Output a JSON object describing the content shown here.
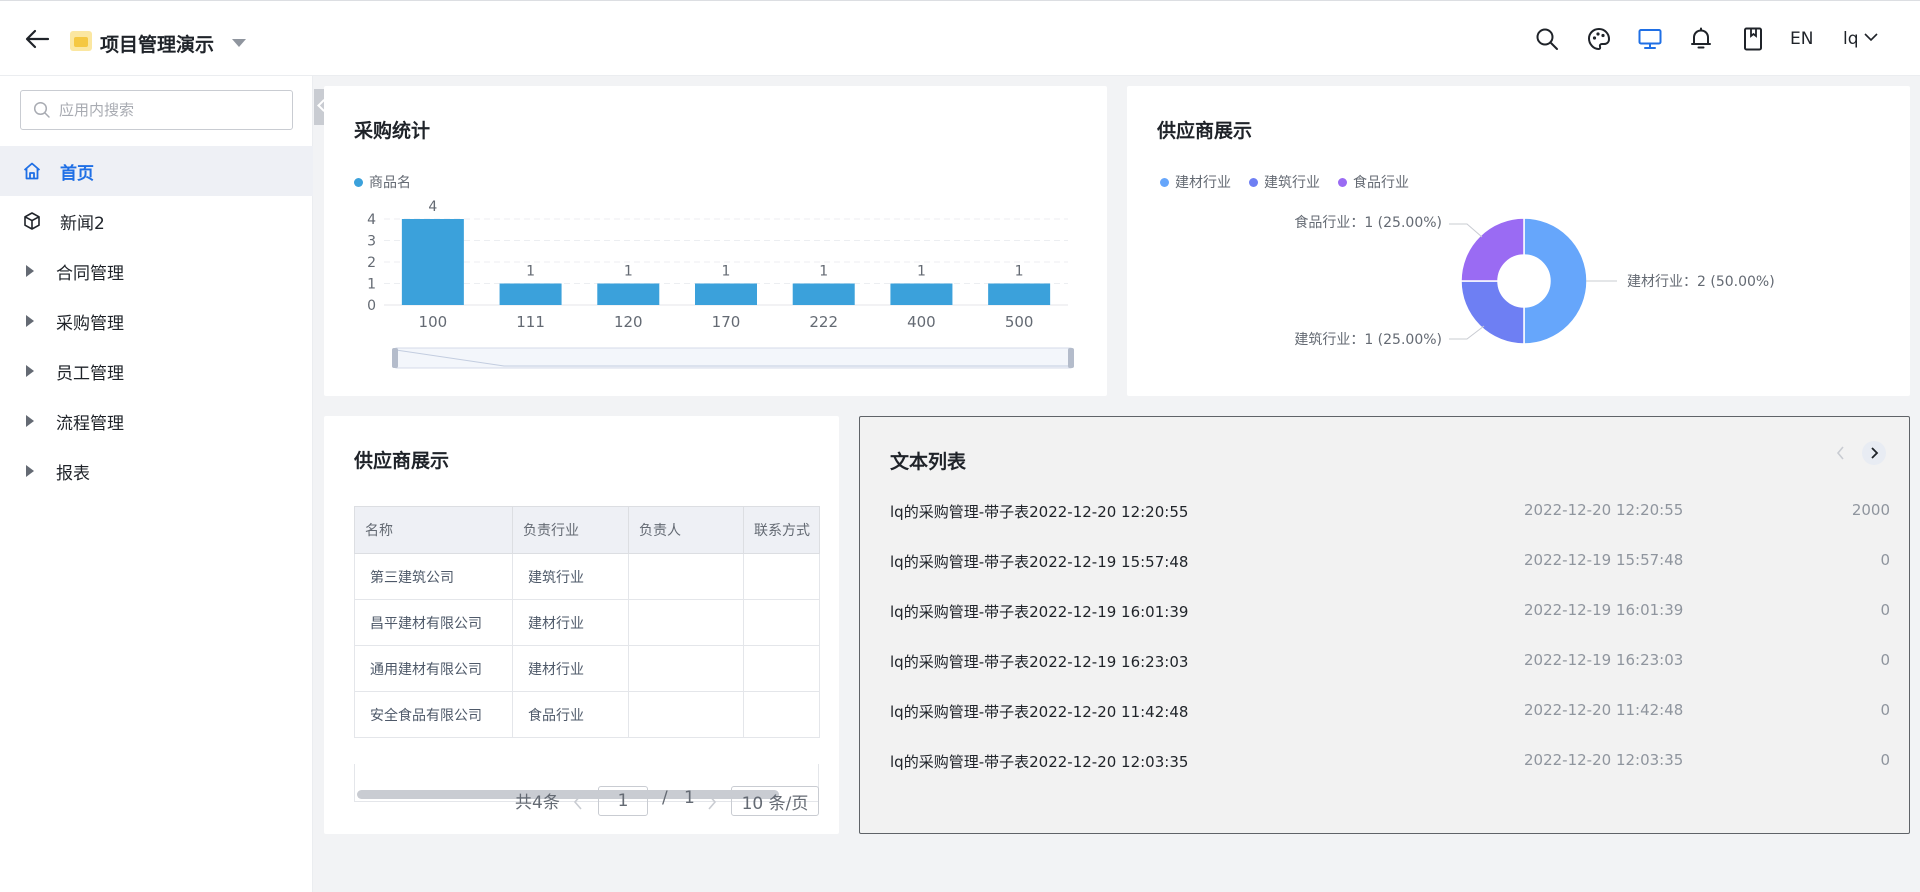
{
  "header": {
    "app_title": "项目管理演示",
    "lang": "EN",
    "user": "lq"
  },
  "sidebar": {
    "search_placeholder": "应用内搜索",
    "items": [
      {
        "label": "首页",
        "icon": "home-icon"
      },
      {
        "label": "新闻2",
        "icon": "cube-icon"
      },
      {
        "label": "合同管理"
      },
      {
        "label": "采购管理"
      },
      {
        "label": "员工管理"
      },
      {
        "label": "流程管理"
      },
      {
        "label": "报表"
      }
    ]
  },
  "colors": {
    "accent": "#1f6fe5",
    "bar": "#3ba1db",
    "pie": [
      "#66a6fb",
      "#6e7ff3",
      "#9a6bf3"
    ]
  },
  "purchase_panel": {
    "title": "采购统计",
    "chart_data": {
      "type": "bar",
      "series": [
        {
          "name": "商品名",
          "values": [
            4,
            1,
            1,
            1,
            1,
            1,
            1
          ]
        }
      ],
      "categories": [
        "100",
        "111",
        "120",
        "170",
        "222",
        "400",
        "500"
      ],
      "yticks": [
        "0",
        "1",
        "2",
        "3",
        "4"
      ],
      "ylim": [
        0,
        4
      ],
      "data_labels": [
        "4",
        "1",
        "1",
        "1",
        "1",
        "1",
        "1"
      ]
    }
  },
  "supplier_pie_panel": {
    "title": "供应商展示",
    "chart_data": {
      "type": "pie",
      "slices": [
        {
          "name": "建材行业",
          "value": 2,
          "label": "建材行业：2 (50.00%)"
        },
        {
          "name": "建筑行业",
          "value": 1,
          "label": "建筑行业：1 (25.00%)"
        },
        {
          "name": "食品行业",
          "value": 1,
          "label": "食品行业：1 (25.00%)"
        }
      ]
    }
  },
  "supplier_table_panel": {
    "title": "供应商展示",
    "columns": [
      "名称",
      "负责行业",
      "负责人",
      "联系方式"
    ],
    "rows": [
      [
        "第三建筑公司",
        "建筑行业",
        "",
        ""
      ],
      [
        "昌平建材有限公司",
        "建材行业",
        "",
        ""
      ],
      [
        "通用建材有限公司",
        "建材行业",
        "",
        ""
      ],
      [
        "安全食品有限公司",
        "食品行业",
        "",
        ""
      ]
    ],
    "pager": {
      "total": "共4条",
      "page": "1",
      "separator": "/",
      "pages": "1",
      "page_size": "10 条/页"
    }
  },
  "text_list_panel": {
    "title": "文本列表",
    "items": [
      {
        "title": "lq的采购管理-带子表2022-12-20 12:20:55",
        "date": "2022-12-20 12:20:55",
        "num": "2000"
      },
      {
        "title": "lq的采购管理-带子表2022-12-19 15:57:48",
        "date": "2022-12-19 15:57:48",
        "num": "0"
      },
      {
        "title": "lq的采购管理-带子表2022-12-19 16:01:39",
        "date": "2022-12-19 16:01:39",
        "num": "0"
      },
      {
        "title": "lq的采购管理-带子表2022-12-19 16:23:03",
        "date": "2022-12-19 16:23:03",
        "num": "0"
      },
      {
        "title": "lq的采购管理-带子表2022-12-20 11:42:48",
        "date": "2022-12-20 11:42:48",
        "num": "0"
      },
      {
        "title": "lq的采购管理-带子表2022-12-20 12:03:35",
        "date": "2022-12-20 12:03:35",
        "num": "0"
      }
    ]
  }
}
